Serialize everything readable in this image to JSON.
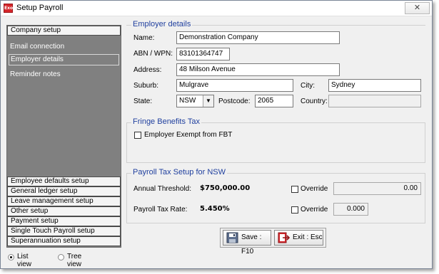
{
  "window": {
    "title": "Setup Payroll",
    "app_icon_text": "Exo",
    "close_glyph": "✕"
  },
  "sidebar": {
    "company_setup": "Company setup",
    "links": [
      "Email connection",
      "Employer details",
      "Reminder notes"
    ],
    "bottom_sections": [
      "Employee defaults setup",
      "General ledger setup",
      "Leave management setup",
      "Other setup",
      "Payment setup",
      "Single Touch Payroll setup",
      "Superannuation setup"
    ]
  },
  "view_toggle": {
    "list_view": "List view",
    "tree_view": "Tree view",
    "selected": "List view"
  },
  "employer": {
    "title": "Employer details",
    "name_label": "Name:",
    "name_value": "Demonstration Company",
    "abn_label": "ABN / WPN:",
    "abn_value": "83101364747",
    "address_label": "Address:",
    "address_value": "48 Milson Avenue",
    "suburb_label": "Suburb:",
    "suburb_value": "Mulgrave",
    "city_label": "City:",
    "city_value": "Sydney",
    "state_label": "State:",
    "state_value": "NSW",
    "postcode_label": "Postcode:",
    "postcode_value": "2065",
    "country_label": "Country:",
    "country_value": ""
  },
  "fbt": {
    "title": "Fringe Benefits Tax",
    "exempt_label": "Employer Exempt from FBT",
    "exempt_checked": false
  },
  "payroll_tax": {
    "title": "Payroll Tax Setup for NSW",
    "threshold_label": "Annual Threshold:",
    "threshold_value": "$750,000.00",
    "override_label": "Override",
    "threshold_override_value": "0.00",
    "rate_label": "Payroll Tax Rate:",
    "rate_value": "5.450%",
    "rate_override_value": "0.000"
  },
  "buttons": {
    "save": "Save : F10",
    "exit": "Exit : Esc"
  },
  "icons": {
    "save": "save-floppy-icon",
    "exit": "exit-door-icon",
    "dropdown": "chevron-down-icon"
  },
  "colors": {
    "group_title": "#1f3f9e",
    "sidebar_bg": "#808080",
    "exit_icon": "#d6262b"
  }
}
